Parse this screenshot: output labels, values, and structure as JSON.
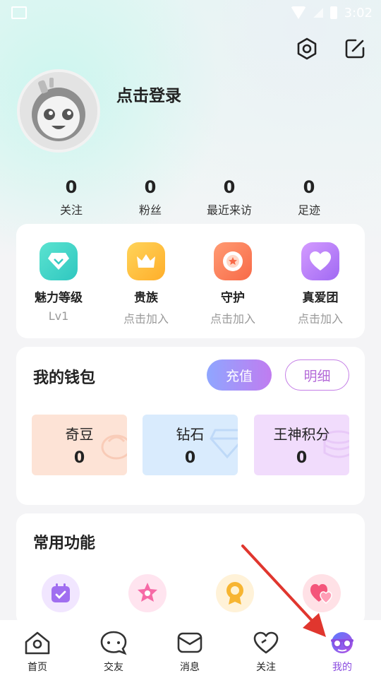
{
  "status_bar": {
    "time": "3:02"
  },
  "profile": {
    "login_text": "点击登录"
  },
  "stats": [
    {
      "value": "0",
      "label": "关注"
    },
    {
      "value": "0",
      "label": "粉丝"
    },
    {
      "value": "0",
      "label": "最近来访"
    },
    {
      "value": "0",
      "label": "足迹"
    }
  ],
  "vip_items": [
    {
      "title": "魅力等级",
      "sub": "Lv1",
      "icon": "diamond-icon"
    },
    {
      "title": "贵族",
      "sub": "点击加入",
      "icon": "crown-icon"
    },
    {
      "title": "守护",
      "sub": "点击加入",
      "icon": "shield-icon"
    },
    {
      "title": "真爱团",
      "sub": "点击加入",
      "icon": "heart-icon"
    }
  ],
  "wallet": {
    "title": "我的钱包",
    "recharge_label": "充值",
    "detail_label": "明细",
    "balances": [
      {
        "name": "奇豆",
        "value": "0",
        "color": "#fde3d6"
      },
      {
        "name": "钻石",
        "value": "0",
        "color": "#d9ebfd"
      },
      {
        "name": "王神积分",
        "value": "0",
        "color": "#f1dcfc"
      }
    ]
  },
  "functions": {
    "title": "常用功能",
    "icons": [
      "calendar-check-icon",
      "star-badge-icon",
      "medal-icon",
      "hearts-icon"
    ]
  },
  "nav": [
    {
      "label": "首页",
      "icon": "home-icon"
    },
    {
      "label": "交友",
      "icon": "chat-icon"
    },
    {
      "label": "消息",
      "icon": "mail-icon"
    },
    {
      "label": "关注",
      "icon": "heart-outline-icon"
    },
    {
      "label": "我的",
      "icon": "avatar-glasses-icon",
      "active": true
    }
  ],
  "colors": {
    "accent": "#8b4de0",
    "arrow": "#e0362e"
  }
}
